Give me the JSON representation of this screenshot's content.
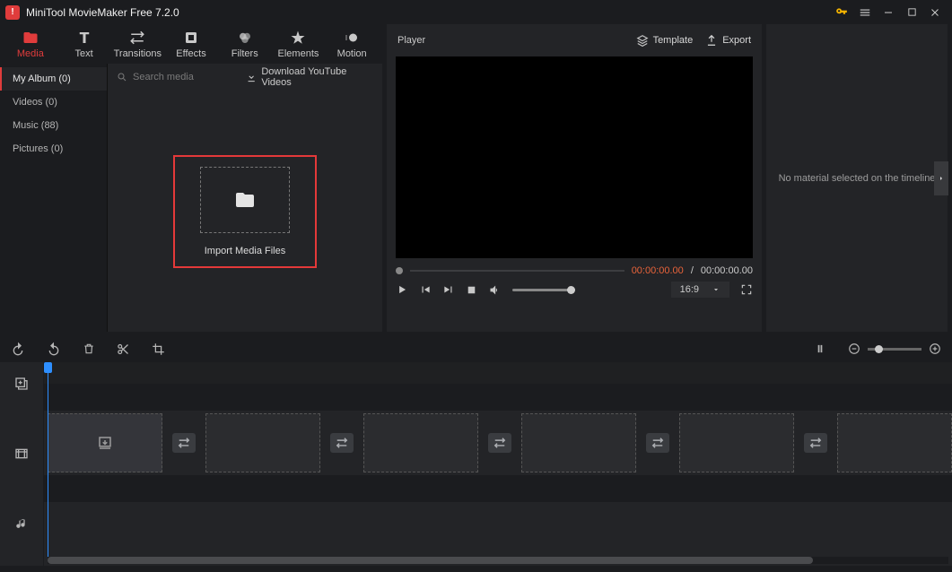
{
  "titlebar": {
    "title": "MiniTool MovieMaker Free 7.2.0"
  },
  "toolbar": {
    "items": [
      {
        "label": "Media"
      },
      {
        "label": "Text"
      },
      {
        "label": "Transitions"
      },
      {
        "label": "Effects"
      },
      {
        "label": "Filters"
      },
      {
        "label": "Elements"
      },
      {
        "label": "Motion"
      }
    ]
  },
  "library": {
    "side": [
      {
        "label": "My Album (0)"
      },
      {
        "label": "Videos (0)"
      },
      {
        "label": "Music (88)"
      },
      {
        "label": "Pictures (0)"
      }
    ],
    "search_placeholder": "Search media",
    "download_label": "Download YouTube Videos",
    "import_label": "Import Media Files"
  },
  "player": {
    "label": "Player",
    "template": "Template",
    "export": "Export",
    "time_cur": "00:00:00.00",
    "time_sep": " / ",
    "time_tot": "00:00:00.00",
    "aspect": "16:9"
  },
  "properties": {
    "empty_text": "No material selected on the timeline"
  }
}
